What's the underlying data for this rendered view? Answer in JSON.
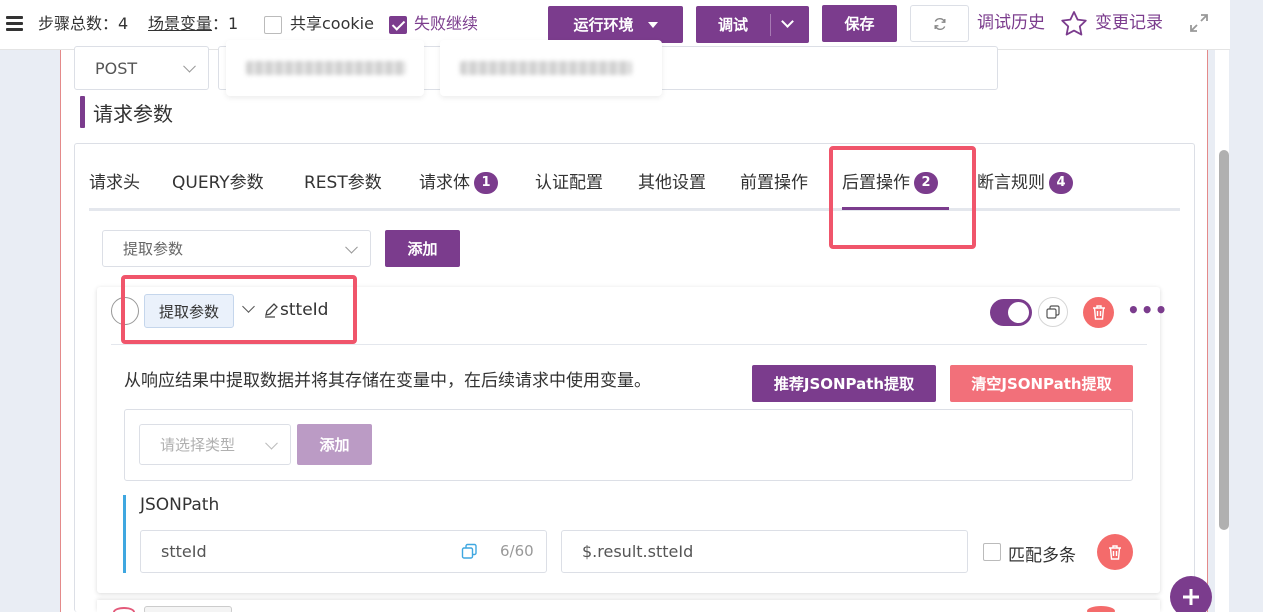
{
  "toolbar": {
    "steps_label": "步骤总数：",
    "steps_count": "4",
    "vars_label": "场景变量",
    "vars_colon": "：",
    "vars_count": "1",
    "share_cookie": "共享cookie",
    "share_cookie_checked": false,
    "fail_continue": "失败继续",
    "fail_continue_checked": true,
    "env_button": "运行环境",
    "debug_button": "调试",
    "save_button": "保存",
    "history_link": "调试历史",
    "changes_link": "变更记录"
  },
  "request": {
    "method": "POST",
    "section_title": "请求参数"
  },
  "tabs": [
    {
      "label": "请求头"
    },
    {
      "label": "QUERY参数"
    },
    {
      "label": "REST参数"
    },
    {
      "label": "请求体",
      "badge": "1"
    },
    {
      "label": "认证配置"
    },
    {
      "label": "其他设置"
    },
    {
      "label": "前置操作"
    },
    {
      "label": "后置操作",
      "badge": "2",
      "active": true
    },
    {
      "label": "断言规则",
      "badge": "4"
    }
  ],
  "post_ops": {
    "type_select": "提取参数",
    "add_button": "添加"
  },
  "card": {
    "tag": "提取参数",
    "name": "stteId",
    "enabled": true,
    "description": "从响应结果中提取数据并将其存储在变量中，在后续请求中使用变量。",
    "recommend_button": "推荐JSONPath提取",
    "clear_button": "清空JSONPath提取",
    "type_placeholder": "请选择类型",
    "inner_add_button": "添加",
    "jsonpath_title": "JSONPath",
    "var_name": "stteId",
    "char_count": "6/60",
    "expression": "$.result.stteId",
    "match_multiple": "匹配多条",
    "match_multiple_checked": false
  },
  "colors": {
    "accent": "#7b3c8d",
    "danger": "#f2707a",
    "highlight": "#f0556b"
  }
}
